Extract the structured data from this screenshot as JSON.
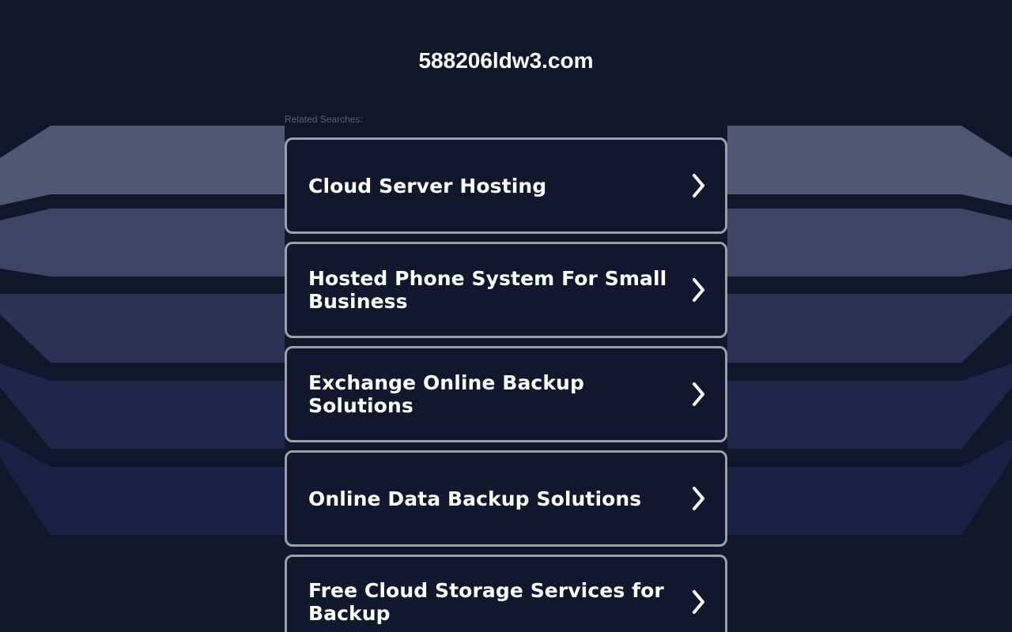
{
  "page": {
    "domain": "588206ldw3.com",
    "related_label": "Related Searches:"
  },
  "results": [
    {
      "label": "Cloud Server Hosting",
      "icon": "chevron-right-icon"
    },
    {
      "label": "Hosted Phone System For Small Business",
      "icon": "chevron-right-icon"
    },
    {
      "label": "Exchange Online Backup Solutions",
      "icon": "chevron-right-icon"
    },
    {
      "label": "Online Data Backup Solutions",
      "icon": "chevron-right-icon"
    },
    {
      "label": "Free Cloud Storage Services for Backup",
      "icon": "chevron-right-icon"
    }
  ],
  "colors": {
    "background": "#10172b",
    "card": "#11182d",
    "border": "#9fa0a7",
    "text": "#ffffff",
    "label": "#5a6278"
  }
}
